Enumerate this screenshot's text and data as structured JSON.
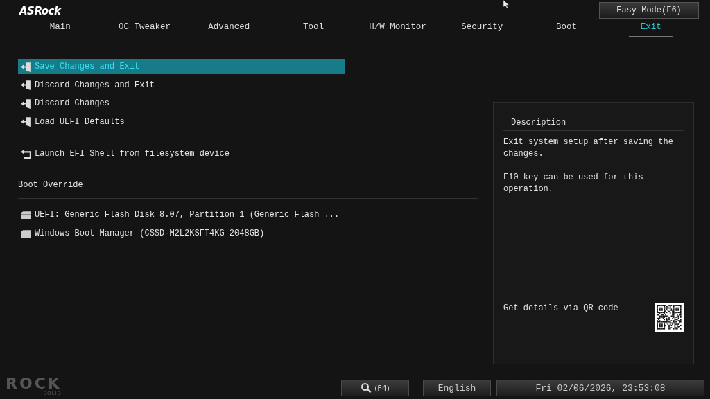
{
  "logo": "ASRock",
  "easy_mode_button": "Easy Mode(F6)",
  "tabs": [
    {
      "label": "Main",
      "selected": false
    },
    {
      "label": "OC Tweaker",
      "selected": false
    },
    {
      "label": "Advanced",
      "selected": false
    },
    {
      "label": "Tool",
      "selected": false
    },
    {
      "label": "H/W Monitor",
      "selected": false
    },
    {
      "label": "Security",
      "selected": false
    },
    {
      "label": "Boot",
      "selected": false
    },
    {
      "label": "Exit",
      "selected": true
    }
  ],
  "menu_items": [
    {
      "label": "Save Changes and Exit",
      "kind": "exit",
      "selected": true
    },
    {
      "label": "Discard Changes and Exit",
      "kind": "exit",
      "selected": false
    },
    {
      "label": "Discard Changes",
      "kind": "exit",
      "selected": false
    },
    {
      "label": "Load UEFI Defaults",
      "kind": "exit",
      "selected": false
    },
    {
      "label": "Launch EFI Shell from filesystem device",
      "kind": "shell",
      "selected": false
    }
  ],
  "boot_override": {
    "title": "Boot Override",
    "devices": [
      {
        "label": "UEFI: Generic Flash Disk 8.07, Partition 1 (Generic Flash ...",
        "selected": false
      },
      {
        "label": "Windows Boot Manager (CSSD-M2L2KSFT4KG 2048GB)",
        "selected": false
      }
    ]
  },
  "description": {
    "title": "Description",
    "paragraphs": [
      "Exit system setup after saving the changes.",
      "F10 key can be used for this operation."
    ],
    "qr_label": "Get details via QR code"
  },
  "footer": {
    "brand": "ROCK",
    "brand_sub": "SOLID",
    "search_key": "(F4)",
    "language": "English",
    "datetime": "Fri 02/06/2026, 23:53:08"
  }
}
